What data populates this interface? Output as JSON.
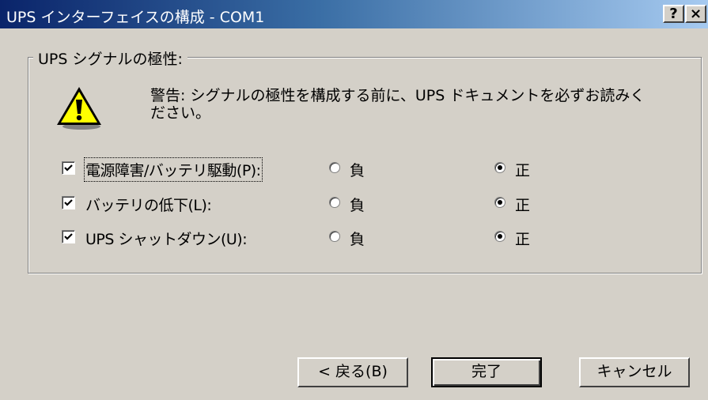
{
  "window": {
    "title": "UPS インターフェイスの構成 - COM1",
    "help_button": "?",
    "close_button": "×"
  },
  "group": {
    "title": "UPS シグナルの極性:",
    "warning_icon": "warning-icon",
    "warning_text": "警告: シグナルの極性を構成する前に、UPS ドキュメントを必ずお読みください。"
  },
  "signals": [
    {
      "label": "電源障害/バッテリ駆動(P):",
      "checked": true,
      "negative_label": "負",
      "positive_label": "正",
      "selected": "positive"
    },
    {
      "label": "バッテリの低下(L):",
      "checked": true,
      "negative_label": "負",
      "positive_label": "正",
      "selected": "positive"
    },
    {
      "label": "UPS シャットダウン(U):",
      "checked": true,
      "negative_label": "負",
      "positive_label": "正",
      "selected": "positive"
    }
  ],
  "buttons": {
    "back": "< 戻る(B)",
    "finish": "完了",
    "cancel": "キャンセル"
  }
}
